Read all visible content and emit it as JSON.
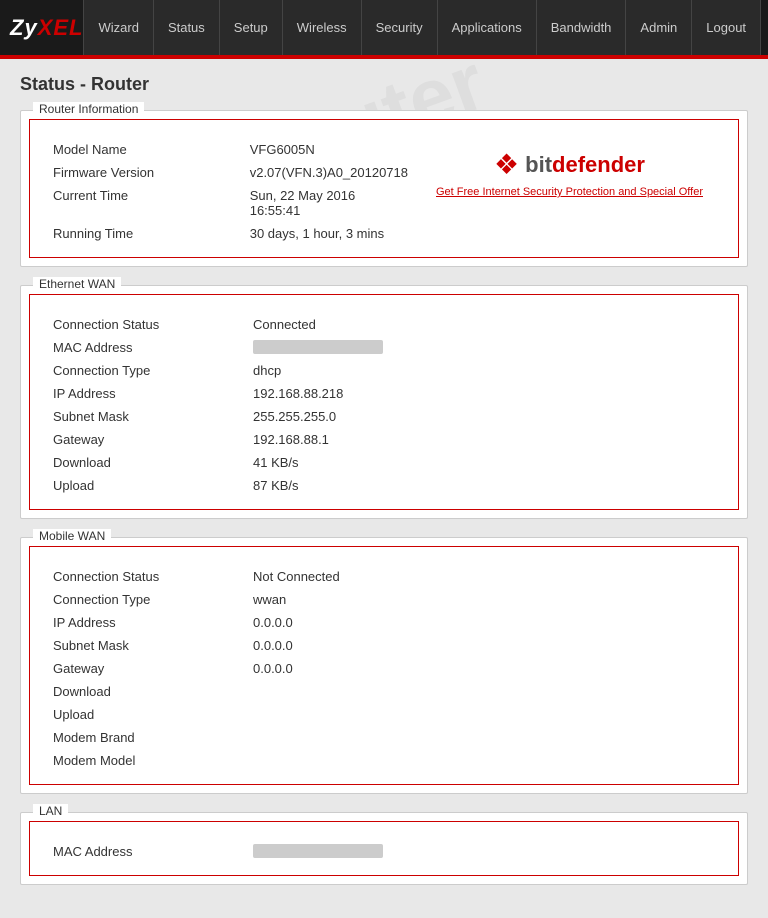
{
  "logo": {
    "text": "ZyXEL"
  },
  "nav": {
    "items": [
      {
        "label": "Wizard",
        "name": "wizard"
      },
      {
        "label": "Status",
        "name": "status"
      },
      {
        "label": "Setup",
        "name": "setup"
      },
      {
        "label": "Wireless",
        "name": "wireless"
      },
      {
        "label": "Security",
        "name": "security"
      },
      {
        "label": "Applications",
        "name": "applications"
      },
      {
        "label": "Bandwidth",
        "name": "bandwidth"
      },
      {
        "label": "Admin",
        "name": "admin"
      },
      {
        "label": "Logout",
        "name": "logout"
      }
    ]
  },
  "page": {
    "title": "Status - Router"
  },
  "router_info": {
    "section_label": "Router Information",
    "rows": [
      {
        "label": "Model Name",
        "value": "VFG6005N"
      },
      {
        "label": "Firmware Version",
        "value": "v2.07(VFN.3)A0_20120718"
      },
      {
        "label": "Current Time",
        "value": "Sun, 22 May 2016 16:55:41"
      },
      {
        "label": "Running Time",
        "value": "30 days, 1 hour, 3 mins"
      }
    ],
    "bitdefender": {
      "logo_text_bit": "bit",
      "logo_text_defender": "defender",
      "link_text": "Get Free Internet Security Protection and Special Offer"
    }
  },
  "ethernet_wan": {
    "section_label": "Ethernet WAN",
    "rows": [
      {
        "label": "Connection Status",
        "value": "Connected"
      },
      {
        "label": "MAC Address",
        "value": "",
        "masked": true
      },
      {
        "label": "Connection Type",
        "value": "dhcp"
      },
      {
        "label": "IP Address",
        "value": "192.168.88.218"
      },
      {
        "label": "Subnet Mask",
        "value": "255.255.255.0"
      },
      {
        "label": "Gateway",
        "value": "192.168.88.1"
      },
      {
        "label": "Download",
        "value": "41 KB/s"
      },
      {
        "label": "Upload",
        "value": "87 KB/s"
      }
    ]
  },
  "mobile_wan": {
    "section_label": "Mobile WAN",
    "rows": [
      {
        "label": "Connection Status",
        "value": "Not Connected"
      },
      {
        "label": "Connection Type",
        "value": "wwan"
      },
      {
        "label": "IP Address",
        "value": "0.0.0.0"
      },
      {
        "label": "Subnet Mask",
        "value": "0.0.0.0"
      },
      {
        "label": "Gateway",
        "value": "0.0.0.0"
      },
      {
        "label": "Download",
        "value": ""
      },
      {
        "label": "Upload",
        "value": ""
      },
      {
        "label": "Modem Brand",
        "value": ""
      },
      {
        "label": "Modem Model",
        "value": ""
      }
    ]
  },
  "lan": {
    "section_label": "LAN",
    "rows": [
      {
        "label": "MAC Address",
        "value": "",
        "masked": true
      }
    ]
  },
  "watermark_text": "setuprouter"
}
